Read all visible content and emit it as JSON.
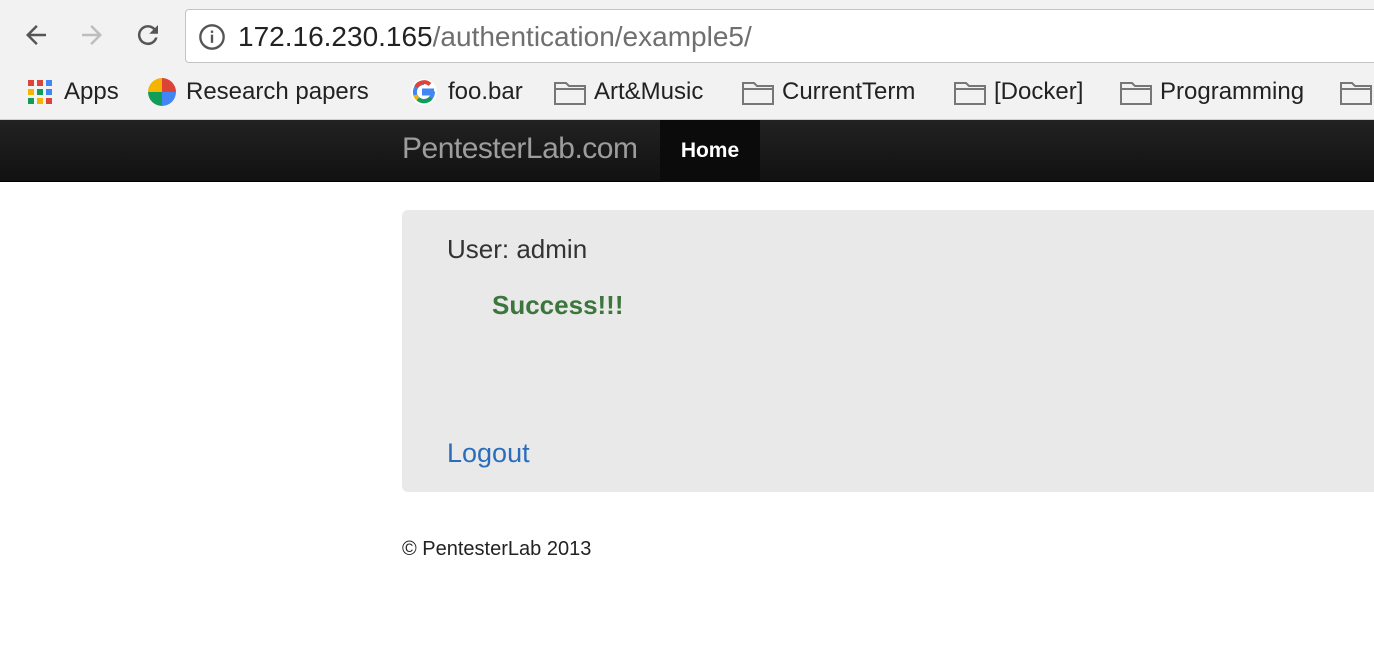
{
  "browser": {
    "url_host": "172.16.230.165",
    "url_path": "/authentication/example5/",
    "bookmarks": [
      {
        "label": "Apps",
        "icon": "apps-grid-icon"
      },
      {
        "label": "Research papers",
        "icon": "google-photos-icon"
      },
      {
        "label": "foo.bar",
        "icon": "google-g-icon"
      },
      {
        "label": "Art&Music",
        "icon": "folder-icon"
      },
      {
        "label": "CurrentTerm",
        "icon": "folder-icon"
      },
      {
        "label": "[Docker]",
        "icon": "folder-icon"
      },
      {
        "label": "Programming",
        "icon": "folder-icon"
      }
    ]
  },
  "navbar": {
    "brand": "PentesterLab.com",
    "home_label": "Home"
  },
  "main": {
    "user_label": "User: admin",
    "success_message": "Success!!!",
    "logout_label": "Logout"
  },
  "footer": {
    "copyright": "© PentesterLab 2013"
  },
  "colors": {
    "success_green": "#3c763d",
    "link_blue": "#2a6ebb",
    "navbar_bg": "#1a1a1a",
    "well_bg": "#e9e9e9"
  }
}
